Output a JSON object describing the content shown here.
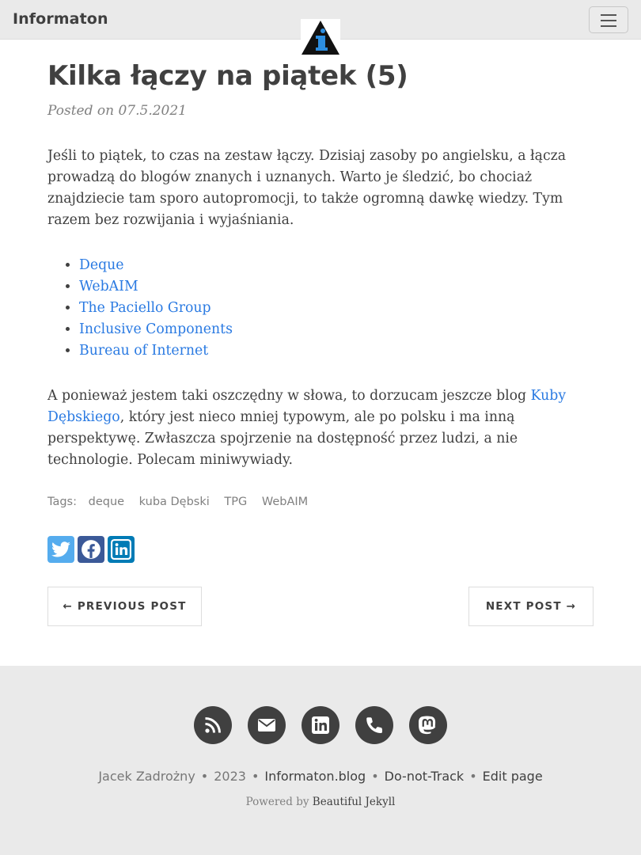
{
  "navbar": {
    "brand": "Informaton",
    "menu_icon": "hamburger-icon",
    "logo_icon": "info-triangle-icon"
  },
  "post": {
    "title": "Kilka łączy na piątek (5)",
    "meta": "Posted on 07.5.2021",
    "intro": "Jeśli to piątek, to czas na zestaw łączy. Dzisiaj zasoby po angielsku, a łącza prowadzą do blogów znanych i uznanych. Warto je śledzić, bo chociaż znajdziecie tam sporo autopromocji, to także ogromną dawkę wiedzy. Tym razem bez rozwijania i wyjaśniania.",
    "links": [
      "Deque",
      "WebAIM",
      "The Paciello Group",
      "Inclusive Components",
      "Bureau of Internet"
    ],
    "outro_before": "A ponieważ jestem taki oszczędny w słowa, to dorzucam jeszcze blog ",
    "outro_link": "Kuby Dębskiego",
    "outro_after": ", który jest nieco mniej typowym, ale po polsku i ma inną perspektywę. Zwłaszcza spojrzenie na dostępność przez ludzi, a nie technologie. Polecam miniwywiady."
  },
  "tags": {
    "label": "Tags:",
    "items": [
      "deque",
      "kuba Dębski",
      "TPG",
      "WebAIM"
    ]
  },
  "share": {
    "icons": [
      "twitter-icon",
      "facebook-icon",
      "linkedin-icon"
    ],
    "colors": {
      "twitter": "#55acee",
      "facebook": "#3b5998",
      "linkedin": "#007bb5"
    }
  },
  "pager": {
    "previous": "← PREVIOUS POST",
    "next": "NEXT POST →"
  },
  "footer": {
    "social_icons": [
      "rss-icon",
      "envelope-icon",
      "linkedin-icon",
      "phone-icon",
      "mastodon-icon"
    ],
    "author": "Jacek Zadrożny",
    "year": "2023",
    "site": "Informaton.blog",
    "dnt": "Do-not-Track",
    "edit": "Edit page",
    "powered_prefix": "Powered by ",
    "powered_link": "Beautiful Jekyll",
    "separator": "•"
  },
  "colors": {
    "link": "#2a7ae2",
    "navbar_bg": "#eaeaea",
    "footer_bg": "#eaeaea",
    "text": "#404040"
  }
}
